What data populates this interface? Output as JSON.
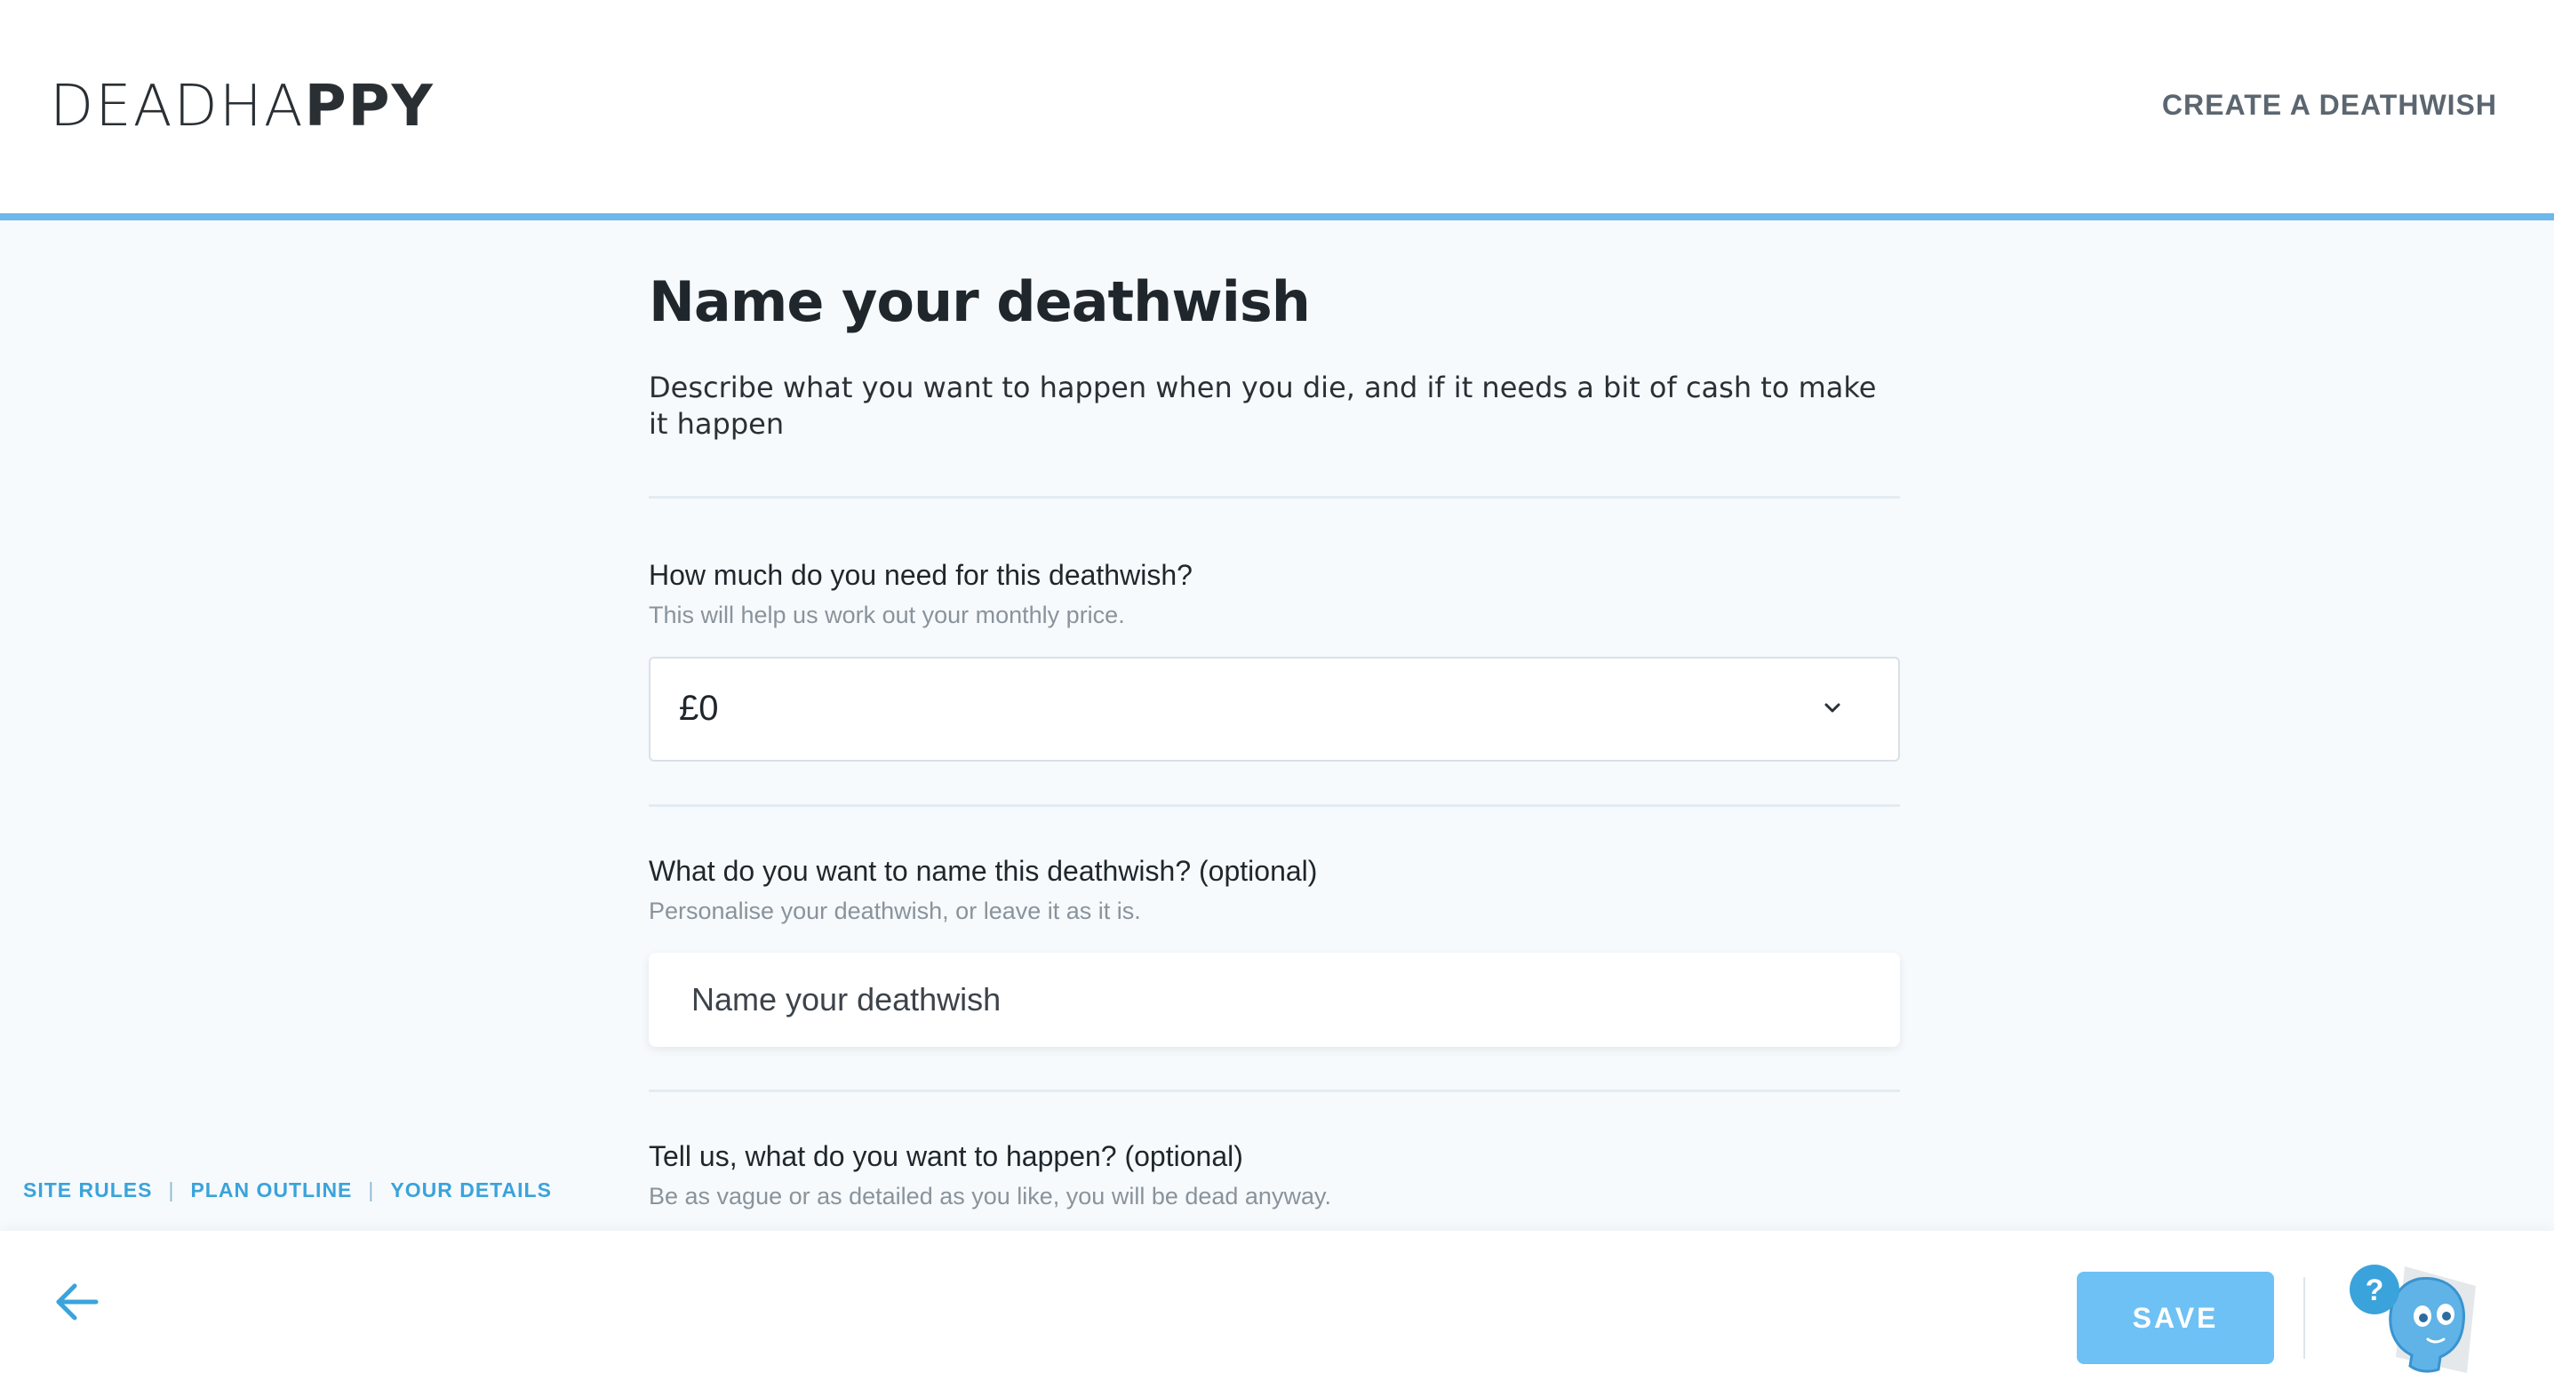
{
  "header": {
    "logo_light": "DEAD",
    "logo_mid": "HA",
    "logo_bold": "PPY",
    "create_link": "CREATE A DEATHWISH"
  },
  "main": {
    "title": "Name your deathwish",
    "description": "Describe what you want to happen when you die, and if it needs a bit of cash to make it happen",
    "amount": {
      "label": "How much do you need for this deathwish?",
      "hint": "This will help us work out your monthly price.",
      "selected": "£0"
    },
    "name": {
      "label": "What do you want to name this deathwish? (optional)",
      "hint": "Personalise your deathwish, or leave it as it is.",
      "placeholder": "Name your deathwish"
    },
    "happen": {
      "label": "Tell us, what do you want to happen? (optional)",
      "hint": "Be as vague or as detailed as you like, you will be dead anyway."
    }
  },
  "footer_links": [
    "SITE RULES",
    "PLAN OUTLINE",
    "YOUR DETAILS"
  ],
  "bottom_bar": {
    "save_label": "SAVE",
    "help_badge": "?"
  },
  "colors": {
    "accent": "#6db8ea",
    "save_button": "#6ec1f4",
    "link": "#3aa3db",
    "page_bg": "#f6fafd"
  },
  "icons": [
    "chevron-down-icon",
    "arrow-left-icon",
    "skull-help-icon"
  ]
}
